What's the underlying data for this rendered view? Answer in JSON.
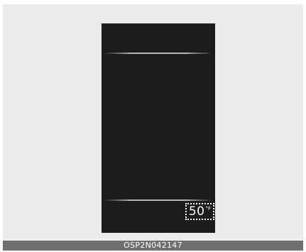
{
  "display": {
    "temperature": {
      "value": "50",
      "unit": "°F"
    }
  },
  "caption": {
    "code": "OSP2N042147"
  },
  "colors": {
    "background": "#ebebeb",
    "screen": "#1c1c1c",
    "caption_bar": "#6f6f6f",
    "text": "#ffffff"
  }
}
